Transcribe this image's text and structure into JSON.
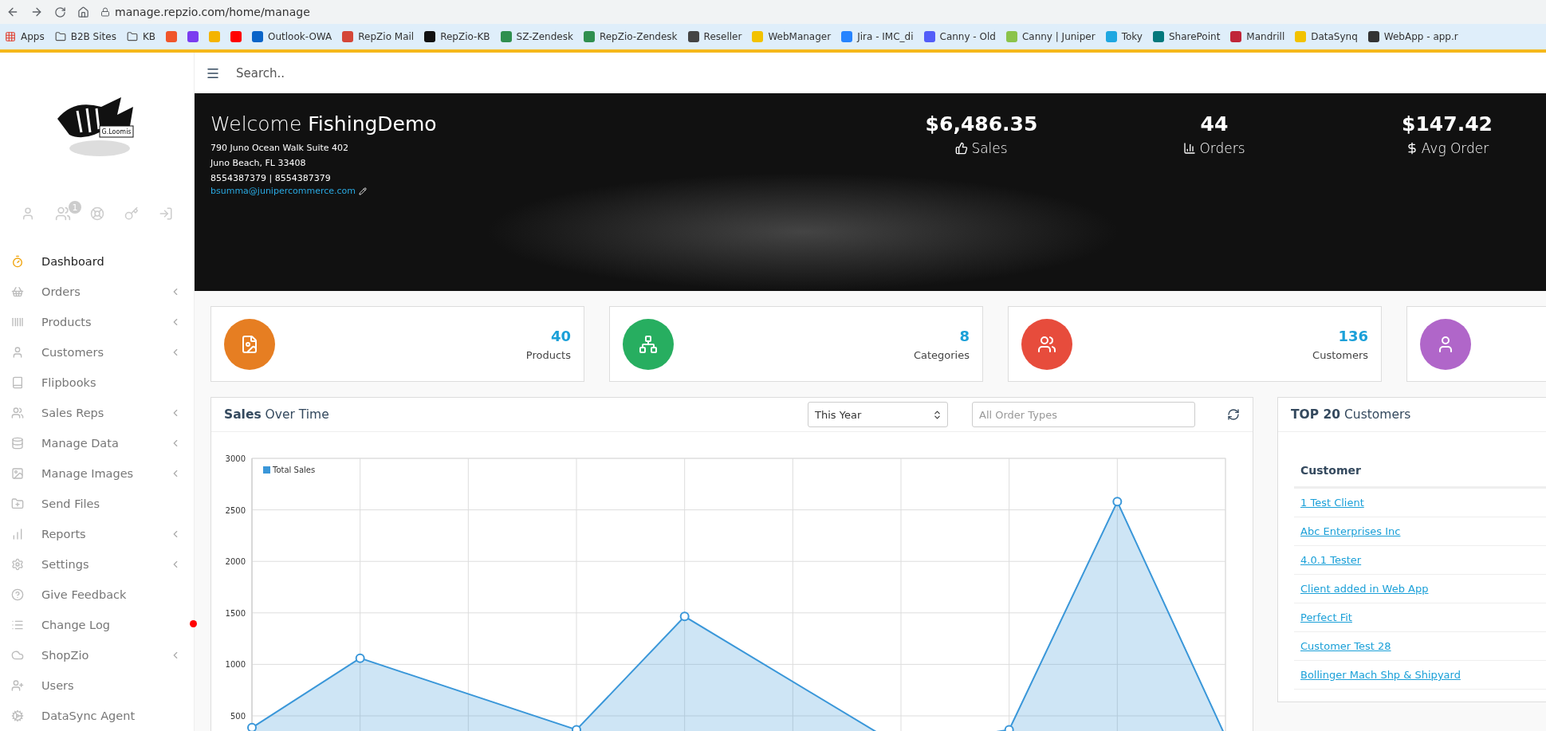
{
  "browser": {
    "url": "manage.repzio.com/home/manage",
    "bookmarks": [
      {
        "kind": "apps",
        "label": "Apps"
      },
      {
        "kind": "folder",
        "label": "B2B Sites"
      },
      {
        "kind": "folder",
        "label": "KB"
      },
      {
        "kind": "site",
        "color": "#f0552b"
      },
      {
        "kind": "site",
        "color": "#7a3cf0"
      },
      {
        "kind": "site",
        "color": "#f4b400"
      },
      {
        "kind": "site",
        "color": "#ff0000"
      },
      {
        "kind": "site",
        "label": "Outlook-OWA",
        "color": "#0a64c8"
      },
      {
        "kind": "site",
        "label": "RepZio Mail",
        "color": "#d44638"
      },
      {
        "kind": "site",
        "label": "RepZio-KB",
        "color": "#111111"
      },
      {
        "kind": "site",
        "label": "SZ-Zendesk",
        "color": "#2f8f4f"
      },
      {
        "kind": "site",
        "label": "RepZio-Zendesk",
        "color": "#2f8f4f"
      },
      {
        "kind": "site",
        "label": "Reseller",
        "color": "#444444"
      },
      {
        "kind": "site",
        "label": "WebManager",
        "color": "#f2c200"
      },
      {
        "kind": "site",
        "label": "Jira - IMC_di",
        "color": "#2684ff"
      },
      {
        "kind": "site",
        "label": "Canny - Old",
        "color": "#525df9"
      },
      {
        "kind": "site",
        "label": "Canny | Juniper",
        "color": "#8bc34a"
      },
      {
        "kind": "site",
        "label": "Toky",
        "color": "#1ea7e1"
      },
      {
        "kind": "site",
        "label": "SharePoint",
        "color": "#03787c"
      },
      {
        "kind": "site",
        "label": "Mandrill",
        "color": "#c02539"
      },
      {
        "kind": "site",
        "label": "DataSynq",
        "color": "#f2c200"
      },
      {
        "kind": "site",
        "label": "WebApp - app.r",
        "color": "#333333"
      }
    ]
  },
  "sidebar": {
    "logo_text": "G.Loomis",
    "icon_badge": "1",
    "items": [
      {
        "label": "Dashboard",
        "selected": true,
        "expandable": false,
        "alert": false
      },
      {
        "label": "Orders",
        "selected": false,
        "expandable": true,
        "alert": false
      },
      {
        "label": "Products",
        "selected": false,
        "expandable": true,
        "alert": false
      },
      {
        "label": "Customers",
        "selected": false,
        "expandable": true,
        "alert": false
      },
      {
        "label": "Flipbooks",
        "selected": false,
        "expandable": false,
        "alert": false
      },
      {
        "label": "Sales Reps",
        "selected": false,
        "expandable": true,
        "alert": false
      },
      {
        "label": "Manage Data",
        "selected": false,
        "expandable": true,
        "alert": false
      },
      {
        "label": "Manage Images",
        "selected": false,
        "expandable": true,
        "alert": false
      },
      {
        "label": "Send Files",
        "selected": false,
        "expandable": false,
        "alert": false
      },
      {
        "label": "Reports",
        "selected": false,
        "expandable": true,
        "alert": false
      },
      {
        "label": "Settings",
        "selected": false,
        "expandable": true,
        "alert": false
      },
      {
        "label": "Give Feedback",
        "selected": false,
        "expandable": false,
        "alert": false
      },
      {
        "label": "Change Log",
        "selected": false,
        "expandable": false,
        "alert": true
      },
      {
        "label": "ShopZio",
        "selected": false,
        "expandable": true,
        "alert": false
      },
      {
        "label": "Users",
        "selected": false,
        "expandable": false,
        "alert": false
      },
      {
        "label": "DataSync Agent",
        "selected": false,
        "expandable": false,
        "alert": false
      }
    ]
  },
  "topbar": {
    "search": {
      "placeholder": "Search.."
    }
  },
  "banner": {
    "welcome": "Welcome **FishingDemo**",
    "address": [
      "790 Juno Ocean Walk Suite 402",
      "Juno Beach, FL 33408",
      "8554387379 | 8554387379"
    ],
    "email": "bsumma@junipercommerce.com",
    "stats": [
      {
        "value": "$6,486.35",
        "label": "Sales"
      },
      {
        "value": "44",
        "label": "Orders"
      },
      {
        "value": "$147.42",
        "label": "Avg Order"
      }
    ]
  },
  "cards": [
    {
      "value": "40",
      "label": "Products",
      "color": "#e67e22"
    },
    {
      "value": "8",
      "label": "Categories",
      "color": "#27ae60"
    },
    {
      "value": "136",
      "label": "Customers",
      "color": "#e74c3c"
    },
    {
      "color": "#b066c9"
    }
  ],
  "sales_panel": {
    "title": "**Sales** Over Time",
    "period": "This Year",
    "order_types": {
      "placeholder": "All Order Types"
    },
    "chart_data": {
      "type": "area",
      "categories": [
        null,
        null,
        null,
        null,
        null,
        null,
        null,
        null,
        null,
        null
      ],
      "series": [
        {
          "name": "Total Sales",
          "color": "#3a97d9",
          "values": [
            385,
            1060,
            null,
            365,
            1465,
            null,
            200,
            365,
            2580,
            300
          ]
        }
      ],
      "ylim": [
        0,
        3000
      ],
      "grid": true,
      "yticks": [
        500,
        1000,
        1500,
        2000,
        2500,
        3000
      ]
    }
  },
  "top_customers": {
    "title": "**TOP 20** Customers",
    "column": "Customer",
    "rows": [
      "1 Test Client",
      "Abc Enterprises Inc",
      "4.0.1 Tester",
      "Client added in Web App",
      "Perfect Fit",
      "Customer Test 28",
      "Bollinger Mach Shp & Shipyard"
    ]
  }
}
